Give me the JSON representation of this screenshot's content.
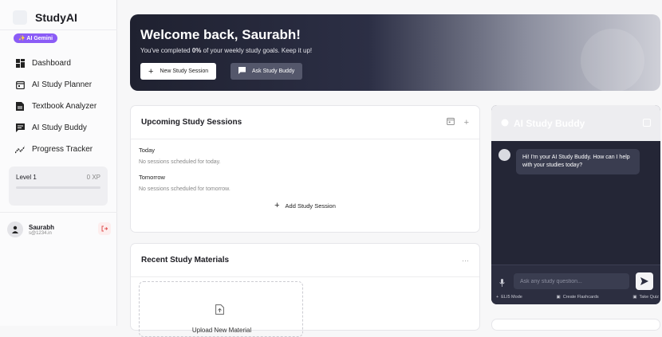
{
  "sidebar": {
    "brand": "StudyAI",
    "badge": "✨ AI Gemini",
    "items": [
      {
        "label": "Dashboard",
        "icon": "dashboard-icon"
      },
      {
        "label": "AI Study Planner",
        "icon": "calendar-icon"
      },
      {
        "label": "Textbook Analyzer",
        "icon": "document-icon"
      },
      {
        "label": "AI Study Buddy",
        "icon": "chat-icon"
      },
      {
        "label": "Progress Tracker",
        "icon": "trend-icon"
      }
    ],
    "level": {
      "label": "Level 1",
      "xp": "0 XP",
      "progress": 0
    },
    "user": {
      "name": "Saurabh",
      "email": "s@1234.in"
    }
  },
  "hero": {
    "title": "Welcome back, Saurabh!",
    "subtitle_pre": "You've completed ",
    "subtitle_value": "0%",
    "subtitle_post": " of your weekly study goals. Keep it up!",
    "new_session": "New Study Session",
    "ask_buddy": "Ask Study Buddy"
  },
  "sessions": {
    "title": "Upcoming Study Sessions",
    "groups": [
      {
        "day": "Today",
        "message": "No sessions scheduled for today."
      },
      {
        "day": "Tomorrow",
        "message": "No sessions scheduled for tomorrow."
      }
    ],
    "add_label": "Add Study Session"
  },
  "materials": {
    "title": "Recent Study Materials",
    "more": "···",
    "upload_label": "Upload New Material"
  },
  "buddy": {
    "title": "AI Study Buddy",
    "greeting": "Hi! I'm your AI Study Buddy. How can I help with your studies today?",
    "placeholder": "Ask any study question...",
    "actions": [
      "ELI5 Mode",
      "Create Flashcards",
      "Take Quiz"
    ]
  }
}
